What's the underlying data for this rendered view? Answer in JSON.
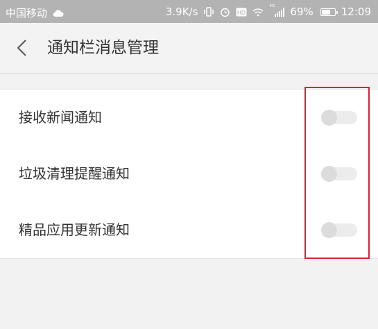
{
  "status_bar": {
    "carrier": "中国移动",
    "speed": "3.9K/s",
    "signal_label": "⁴ᴳ",
    "battery_percent": "69%",
    "battery_level": 0.69,
    "time": "12:09",
    "icons": [
      "cloud-icon",
      "vibrate-icon",
      "alarm-icon",
      "hd-icon",
      "wifi-icon",
      "signal-icon",
      "battery-icon"
    ]
  },
  "header": {
    "title": "通知栏消息管理",
    "back_icon": "chevron-left-icon"
  },
  "settings": {
    "items": [
      {
        "label": "接收新闻通知",
        "enabled": false
      },
      {
        "label": "垃圾清理提醒通知",
        "enabled": false
      },
      {
        "label": "精品应用更新通知",
        "enabled": false
      }
    ]
  },
  "colors": {
    "status_bar_bg": "#b3b3b3",
    "page_bg": "#f2f2f2",
    "highlight": "#e0202f",
    "toggle_off_track": "#ececec",
    "toggle_off_knob": "#dcdcdc",
    "text": "#333333"
  }
}
